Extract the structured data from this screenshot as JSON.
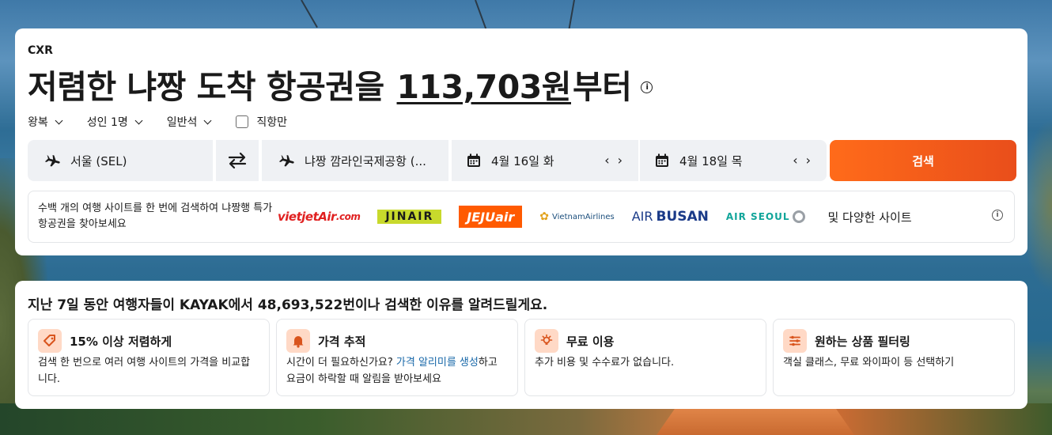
{
  "search": {
    "airport_code": "CXR",
    "headline_prefix": "저렴한 냐짱 도착 항공권을 ",
    "headline_price": "113,703원",
    "headline_suffix": "부터",
    "options": {
      "trip_type": "왕복",
      "passengers": "성인 1명",
      "cabin": "일반석",
      "direct_only": "직항만"
    },
    "origin": "서울 (SEL)",
    "destination": "냐짱 깜라인국제공항 (...",
    "depart_date": "4월 16일 화",
    "return_date": "4월 18일 목",
    "search_button": "검색",
    "partners_desc": "수백 개의 여행 사이트를 한 번에 검색하여 냐짱행 특가 항공권을 찾아보세요",
    "partners": {
      "vietjet": "vietjetAir",
      "vietjet_suffix": ".com",
      "jinair": "JINAIR",
      "jeju": "JEJUair",
      "vietnam": "VietnamAirlines",
      "busan_top": "AIR",
      "busan_bottom": "BUSAN",
      "seoul": "AIR SEOUL"
    },
    "more_sites": "및 다양한 사이트"
  },
  "reasons": {
    "title_prefix": "지난 7일 동안 여행자들이 KAYAK에서 ",
    "title_count": "48,693,522",
    "title_suffix": "번이나 검색한 이유를 알려드릴게요.",
    "items": [
      {
        "title": "15% 이상 저렴하게",
        "body": "검색 한 번으로 여러 여행 사이트의 가격을 비교합니다.",
        "link": ""
      },
      {
        "title": "가격 추적",
        "body_prefix": "시간이 더 필요하신가요? ",
        "link": "가격 알리미를 생성",
        "body_suffix": "하고 요금이 하락할 때 알림을 받아보세요"
      },
      {
        "title": "무료 이용",
        "body": "추가 비용 및 수수료가 없습니다."
      },
      {
        "title": "원하는 상품 필터링",
        "body": "객실 클래스, 무료 와이파이 등 선택하기"
      }
    ]
  },
  "colors": {
    "accent": "#ff6b1a",
    "accent_dark": "#e94e1b",
    "link": "#1767a8",
    "icon_bg": "#ffd9c6"
  },
  "icons": {
    "plane": "plane-icon",
    "swap": "swap-icon",
    "calendar": "calendar-icon",
    "info": "info-icon"
  }
}
